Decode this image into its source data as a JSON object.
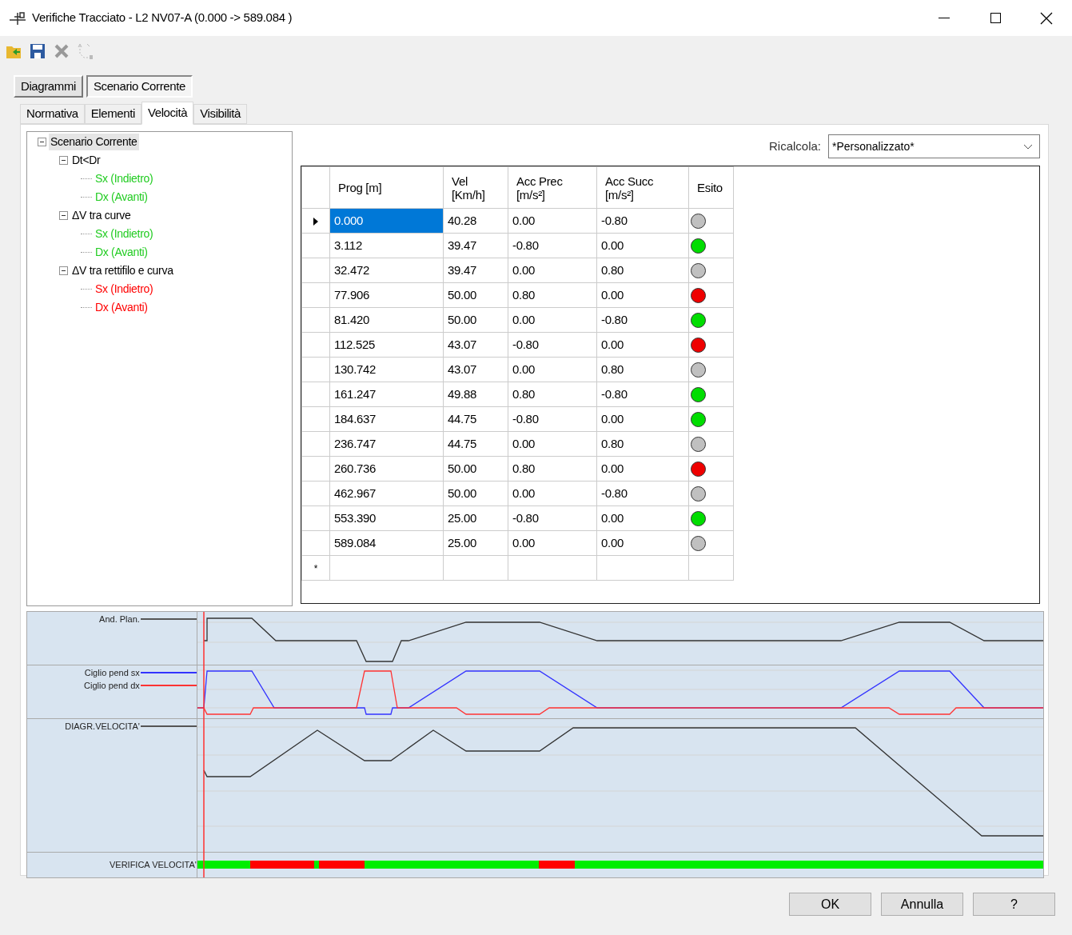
{
  "window": {
    "title": "Verifiche Tracciato - L2 NV07-A (0.000 -> 589.084 )"
  },
  "mode_tabs": [
    {
      "label": "Diagrammi",
      "selected": false
    },
    {
      "label": "Scenario Corrente",
      "selected": true
    }
  ],
  "tabs": [
    {
      "label": "Normativa",
      "selected": false
    },
    {
      "label": "Elementi",
      "selected": false
    },
    {
      "label": "Velocità",
      "selected": true
    },
    {
      "label": "Visibilità",
      "selected": false
    }
  ],
  "tree": [
    {
      "label": "Scenario Corrente",
      "expanded": true,
      "selected": true,
      "children": [
        {
          "label": "Dt<Dr",
          "expanded": true,
          "children": [
            {
              "label": "Sx (Indietro)",
              "color": "#22cc22"
            },
            {
              "label": "Dx (Avanti)",
              "color": "#22cc22"
            }
          ]
        },
        {
          "label": "ΔV tra curve",
          "expanded": true,
          "children": [
            {
              "label": "Sx (Indietro)",
              "color": "#22cc22"
            },
            {
              "label": "Dx (Avanti)",
              "color": "#22cc22"
            }
          ]
        },
        {
          "label": "ΔV tra rettifilo e curva",
          "expanded": true,
          "children": [
            {
              "label": "Sx (Indietro)",
              "color": "#ff0000"
            },
            {
              "label": "Dx (Avanti)",
              "color": "#ff0000"
            }
          ]
        }
      ]
    }
  ],
  "recalc": {
    "label": "Ricalcola:",
    "value": "*Personalizzato*"
  },
  "table": {
    "columns": [
      "Prog [m]",
      "Vel\n[Km/h]",
      "Acc Prec\n[m/s²]",
      "Acc Succ\n[m/s²]",
      "Esito"
    ],
    "new_row_marker": "*",
    "rows": [
      {
        "cells": [
          "0.000",
          "40.28",
          "0.00",
          "-0.80"
        ],
        "color": "#c0c0c0",
        "selected": true
      },
      {
        "cells": [
          "3.112",
          "39.47",
          "-0.80",
          "0.00"
        ],
        "color": "#00dd00",
        "selected": false
      },
      {
        "cells": [
          "32.472",
          "39.47",
          "0.00",
          "0.80"
        ],
        "color": "#c0c0c0",
        "selected": false
      },
      {
        "cells": [
          "77.906",
          "50.00",
          "0.80",
          "0.00"
        ],
        "color": "#ee0000",
        "selected": false
      },
      {
        "cells": [
          "81.420",
          "50.00",
          "0.00",
          "-0.80"
        ],
        "color": "#00dd00",
        "selected": false
      },
      {
        "cells": [
          "112.525",
          "43.07",
          "-0.80",
          "0.00"
        ],
        "color": "#ee0000",
        "selected": false
      },
      {
        "cells": [
          "130.742",
          "43.07",
          "0.00",
          "0.80"
        ],
        "color": "#c0c0c0",
        "selected": false
      },
      {
        "cells": [
          "161.247",
          "49.88",
          "0.80",
          "-0.80"
        ],
        "color": "#00dd00",
        "selected": false
      },
      {
        "cells": [
          "184.637",
          "44.75",
          "-0.80",
          "0.00"
        ],
        "color": "#00dd00",
        "selected": false
      },
      {
        "cells": [
          "236.747",
          "44.75",
          "0.00",
          "0.80"
        ],
        "color": "#c0c0c0",
        "selected": false
      },
      {
        "cells": [
          "260.736",
          "50.00",
          "0.80",
          "0.00"
        ],
        "color": "#ee0000",
        "selected": false
      },
      {
        "cells": [
          "462.967",
          "50.00",
          "0.00",
          "-0.80"
        ],
        "color": "#c0c0c0",
        "selected": false
      },
      {
        "cells": [
          "553.390",
          "25.00",
          "-0.80",
          "0.00"
        ],
        "color": "#00dd00",
        "selected": false
      },
      {
        "cells": [
          "589.084",
          "25.00",
          "0.00",
          "0.00"
        ],
        "color": "#c0c0c0",
        "selected": false
      }
    ]
  },
  "diagram": {
    "tracks": [
      {
        "kind": "plan",
        "labels": [
          {
            "text": "And. Plan.",
            "color": "#555555"
          }
        ]
      },
      {
        "kind": "slope",
        "labels": [
          {
            "text": "Ciglio pend sx",
            "color": "#3333ff"
          },
          {
            "text": "Ciglio pend dx",
            "color": "#ff3333"
          }
        ]
      },
      {
        "kind": "speed",
        "labels": [
          {
            "text": "DIAGR.VELOCITA'",
            "color": "#555555"
          }
        ]
      },
      {
        "kind": "check",
        "labels": [
          {
            "text": "VERIFICA VELOCITA'"
          }
        ]
      }
    ]
  },
  "buttons": [
    "OK",
    "Annulla",
    "?"
  ]
}
